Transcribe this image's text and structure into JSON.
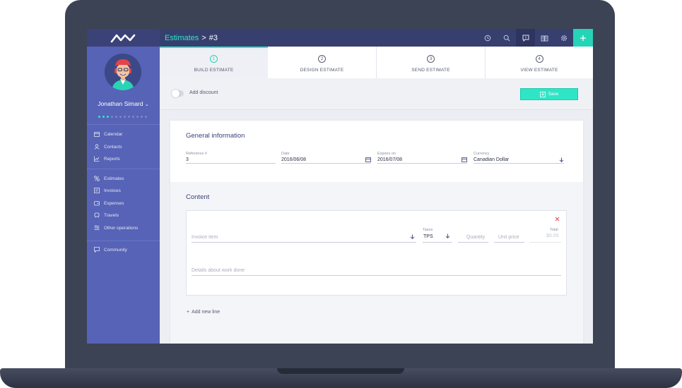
{
  "app": {
    "logo": "app-logo-icon",
    "breadcrumb": {
      "parent": "Estimates",
      "separator": ">",
      "current": "#3"
    }
  },
  "topbar": {
    "icons": [
      "history-icon",
      "search-icon",
      "feedback-icon",
      "book-icon",
      "gear-icon",
      "plus-icon"
    ]
  },
  "sidebar": {
    "user_name": "Jonathan Simard",
    "progress_dots": {
      "filled": 3,
      "total": 12
    },
    "groups": [
      [
        {
          "label": "Calendar",
          "icon": "calendar-icon"
        },
        {
          "label": "Contacts",
          "icon": "contacts-icon"
        },
        {
          "label": "Reports",
          "icon": "reports-icon"
        }
      ],
      [
        {
          "label": "Estimates",
          "icon": "estimates-icon"
        },
        {
          "label": "Invoices",
          "icon": "invoices-icon"
        },
        {
          "label": "Expenses",
          "icon": "expenses-icon"
        },
        {
          "label": "Travels",
          "icon": "travels-icon"
        },
        {
          "label": "Other operations",
          "icon": "other-operations-icon"
        }
      ],
      [
        {
          "label": "Community",
          "icon": "community-icon"
        }
      ]
    ]
  },
  "steps": [
    {
      "num": "1",
      "label": "BUILD ESTIMATE",
      "active": true
    },
    {
      "num": "2",
      "label": "DESIGN ESTIMATE",
      "active": false
    },
    {
      "num": "3",
      "label": "SEND ESTIMATE",
      "active": false
    },
    {
      "num": "4",
      "label": "VIEW ESTIMATE",
      "active": false
    }
  ],
  "subbar": {
    "discount_label": "Add discount",
    "discount_enabled": false,
    "save_label": "Save"
  },
  "general": {
    "title": "General information",
    "reference": {
      "label": "Reference #",
      "value": "3"
    },
    "date": {
      "label": "Date",
      "value": "2016/06/08"
    },
    "expires": {
      "label": "Expires on",
      "value": "2016/07/08"
    },
    "currency": {
      "label": "Currency",
      "value": "Canadian Dollar"
    }
  },
  "content": {
    "title": "Content",
    "line": {
      "item_placeholder": "Invoice item",
      "taxes_label": "Taxes",
      "taxes_value": "TPS",
      "quantity_placeholder": "Quantity",
      "unit_price_placeholder": "Unit price",
      "total_label": "Total",
      "total_value": "$0.00",
      "details_placeholder": "Details about work done"
    },
    "add_line_label": "Add new line"
  },
  "colors": {
    "accent": "#2ee6c6",
    "sidebar": "#5663b6",
    "topbar": "#373f6e",
    "title": "#3a427a",
    "remove": "#e5484d"
  }
}
